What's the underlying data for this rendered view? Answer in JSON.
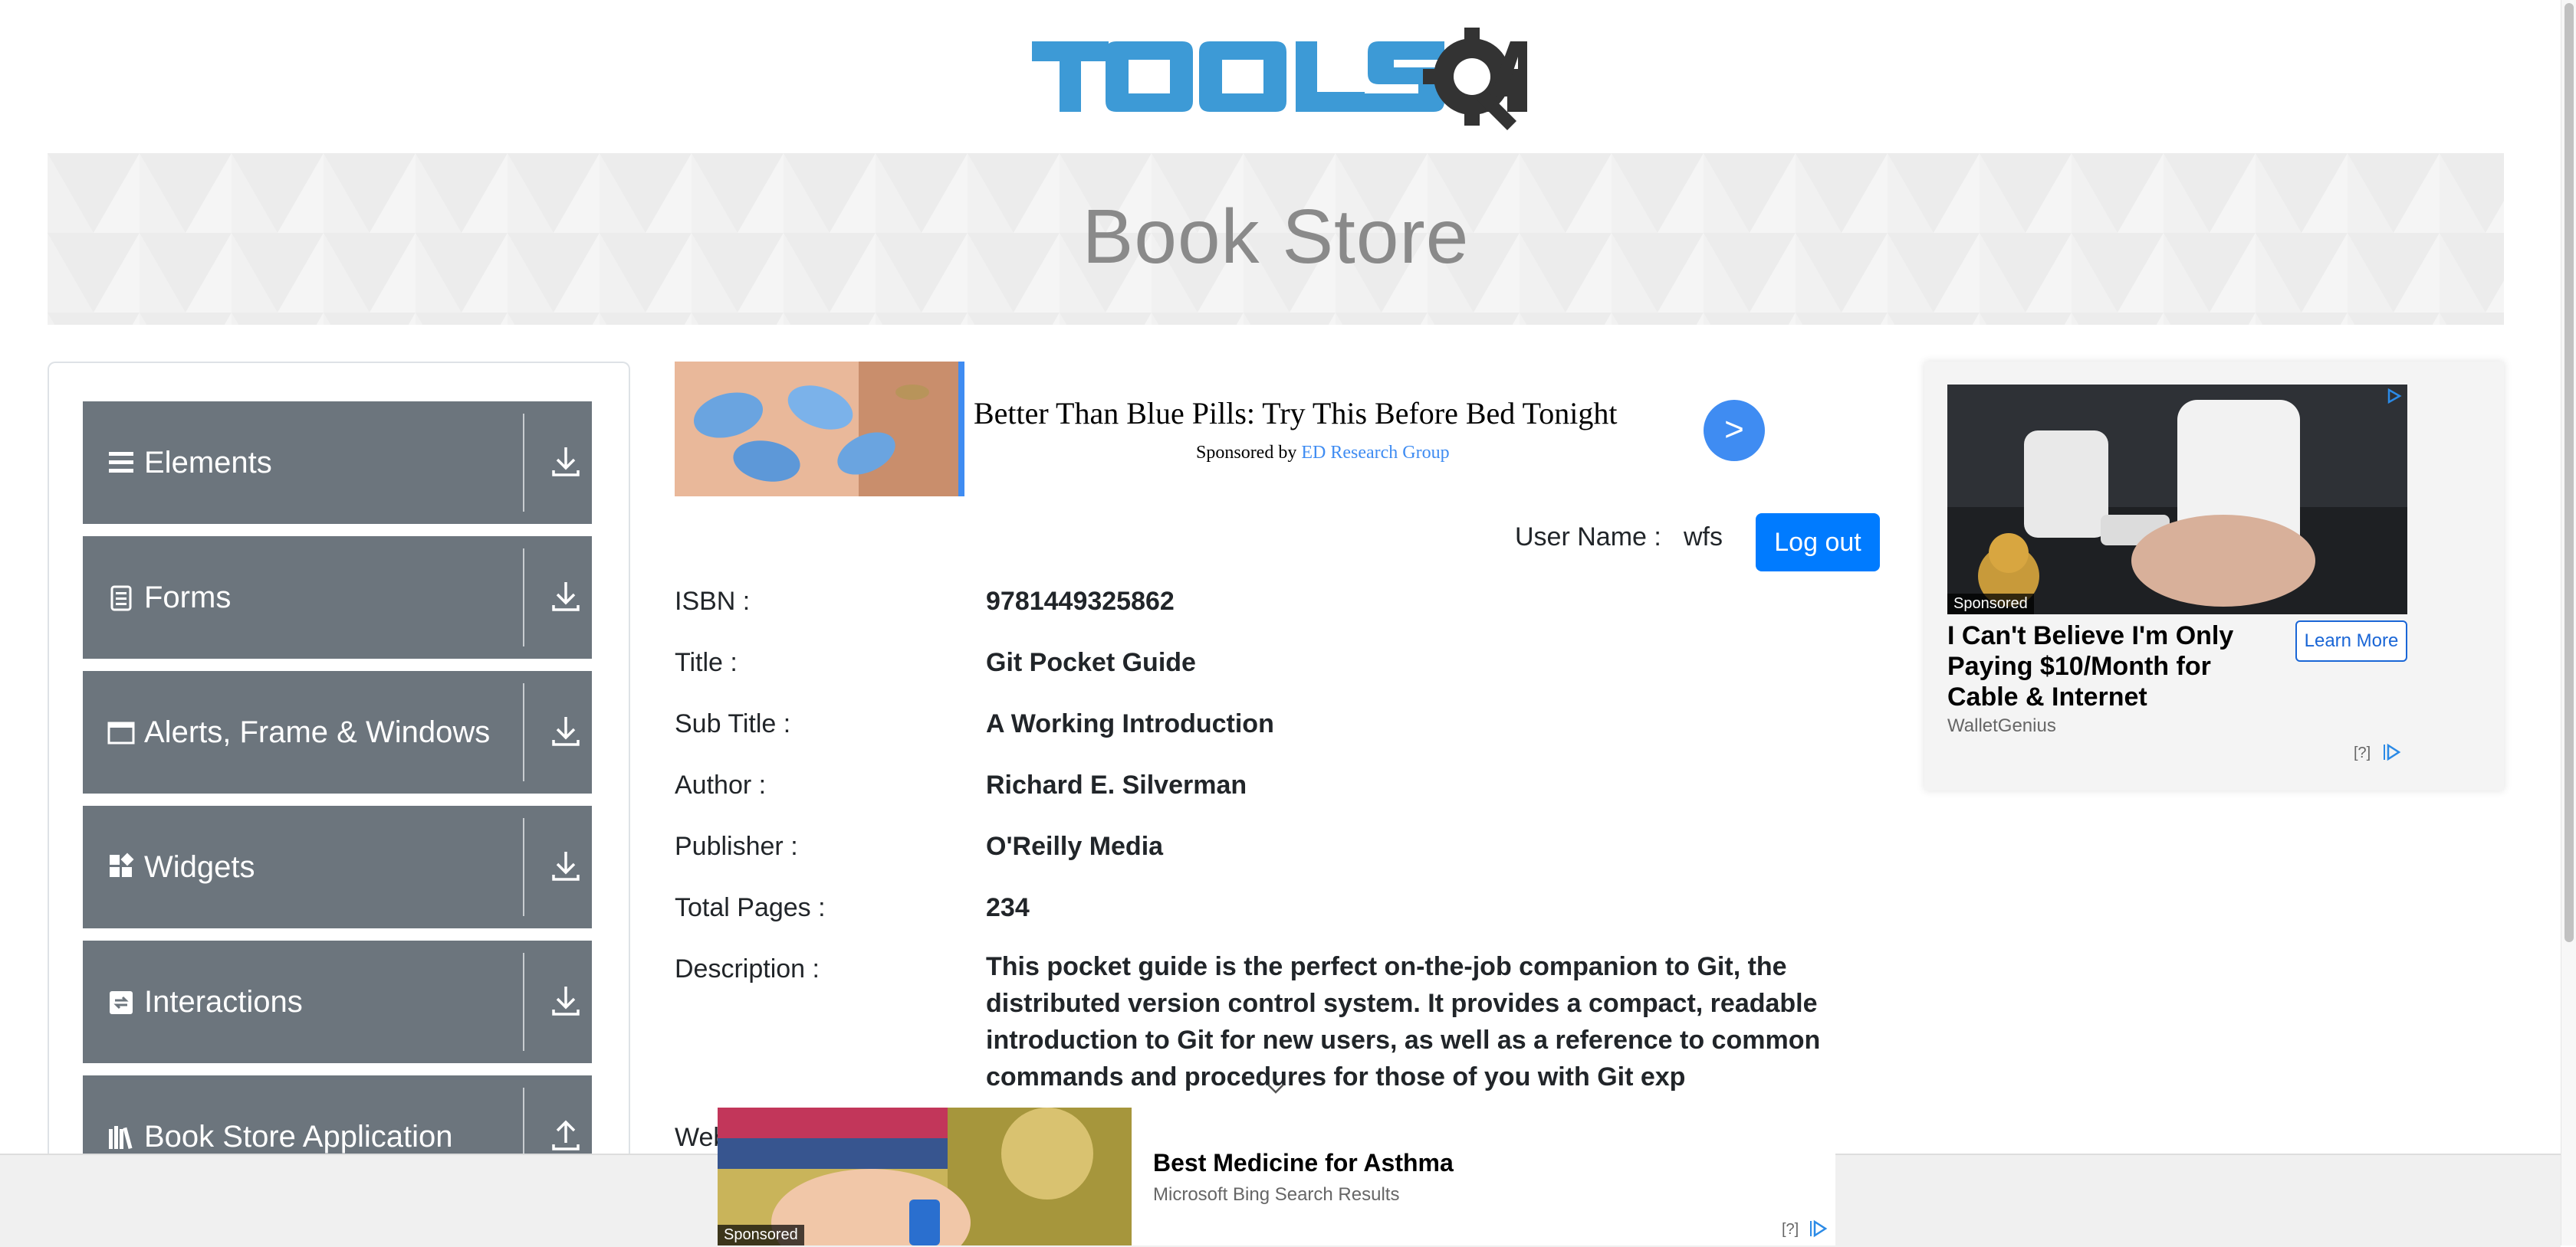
{
  "brand": {
    "logo_text": "TOOLSQA"
  },
  "banner": {
    "title": "Book Store"
  },
  "sidebar": {
    "groups": [
      {
        "label": "Elements",
        "icon": "menu-lines-icon",
        "state": "collapsed"
      },
      {
        "label": "Forms",
        "icon": "document-icon",
        "state": "collapsed"
      },
      {
        "label": "Alerts, Frame & Windows",
        "icon": "window-icon",
        "state": "collapsed"
      },
      {
        "label": "Widgets",
        "icon": "widgets-icon",
        "state": "collapsed"
      },
      {
        "label": "Interactions",
        "icon": "interactions-icon",
        "state": "collapsed"
      },
      {
        "label": "Book Store Application",
        "icon": "books-icon",
        "state": "expanded"
      }
    ]
  },
  "ad_top": {
    "headline": "Better Than Blue Pills: Try This Before Bed Tonight",
    "sponsored_prefix": "Sponsored by",
    "sponsor": "ED Research Group",
    "button": ">"
  },
  "user": {
    "label": "User Name :",
    "value": "wfs",
    "logout": "Log out"
  },
  "book": {
    "isbn_label": "ISBN :",
    "isbn": "9781449325862",
    "title_label": "Title :",
    "title": "Git Pocket Guide",
    "subtitle_label": "Sub Title :",
    "subtitle": "A Working Introduction",
    "author_label": "Author :",
    "author": "Richard E. Silverman",
    "publisher_label": "Publisher :",
    "publisher": "O'Reilly Media",
    "pages_label": "Total Pages :",
    "pages": "234",
    "description_label": "Description :",
    "description": "This pocket guide is the perfect on-the-job companion to Git, the distributed version control system. It provides a compact, readable introduction to Git for new users, as well as a reference to common commands and procedures for those of you with Git exp",
    "website_label_partial": "Web"
  },
  "ad_right": {
    "tag": "Sponsored",
    "headline": "I Can't Believe I'm Only Paying $10/Month for Cable & Internet",
    "source": "WalletGenius",
    "button": "Learn More",
    "help": "[?]"
  },
  "ad_bottom": {
    "tag": "Sponsored",
    "headline": "Best Medicine for Asthma",
    "source": "Microsoft Bing Search Results",
    "help": "[?]"
  },
  "colors": {
    "accent": "#007bff",
    "sidebar_bg": "#6c757d",
    "logo_blue": "#3d9ad6",
    "logo_dark": "#333333",
    "ad_blue": "#3f8cf2"
  }
}
